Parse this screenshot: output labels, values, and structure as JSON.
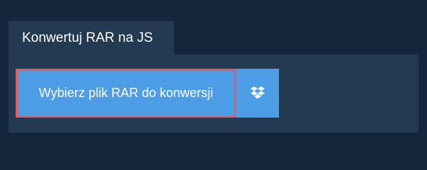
{
  "tab": {
    "label": "Konwertuj RAR na JS"
  },
  "converter": {
    "select_file_label": "Wybierz plik RAR do konwersji",
    "dropbox_icon": "dropbox-icon"
  },
  "colors": {
    "page_background": "#14263b",
    "panel_background": "#233a52",
    "button_background": "#4c9de6",
    "focus_outline": "#e25d5d",
    "text": "#ffffff"
  }
}
